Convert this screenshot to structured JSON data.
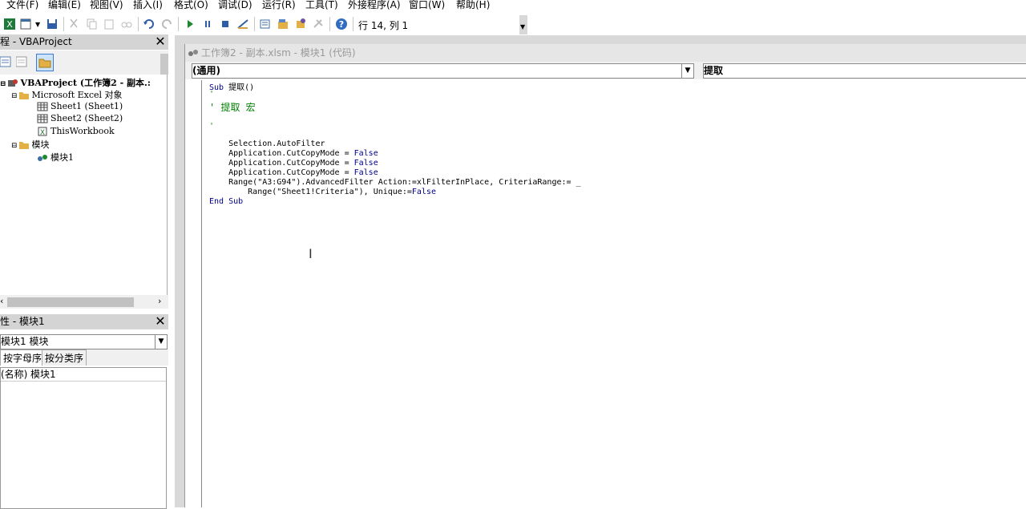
{
  "menu": [
    "文件(F)",
    "编辑(E)",
    "视图(V)",
    "插入(I)",
    "格式(O)",
    "调试(D)",
    "运行(R)",
    "工具(T)",
    "外接程序(A)",
    "窗口(W)",
    "帮助(H)"
  ],
  "toolbar": {
    "position": "行 14, 列 1"
  },
  "project": {
    "title": "程 - VBAProject",
    "root": "VBAProject (工作簿2 - 副本.:",
    "excel_objects": "Microsoft Excel 对象",
    "sheet1": "Sheet1 (Sheet1)",
    "sheet2": "Sheet2 (Sheet2)",
    "thisworkbook": "ThisWorkbook",
    "modules": "模块",
    "module1": "模块1"
  },
  "properties": {
    "title": "性 - 模块1",
    "combo": "模块1 模块",
    "tab_alpha": "按字母序",
    "tab_cat": "按分类序",
    "row_name": "(名称)",
    "row_value": "模块1"
  },
  "code_window": {
    "title": "工作簿2 - 副本.xlsm - 模块1 (代码)",
    "object_combo": "(通用)",
    "proc_combo": "提取"
  },
  "code": {
    "l1_kw": "Sub",
    "l1": " 提取()",
    "l2": "'",
    "l3": "' 提取 宏",
    "l4": "'",
    "l5": "    Selection.AutoFilter",
    "l6": "    Application.CutCopyMode = ",
    "l7": "    Application.CutCopyMode = ",
    "l8": "    Application.CutCopyMode = ",
    "false_kw": "False",
    "l9": "    Range(\"A3:G94\").AdvancedFilter Action:=xlFilterInPlace, CriteriaRange:= _",
    "l10": "        Range(\"Sheet1!Criteria\"), Unique:=",
    "l11_end": "End",
    "l11_sub": "Sub"
  },
  "colors": {
    "keyword": "#00008b",
    "comment": "#008000"
  }
}
